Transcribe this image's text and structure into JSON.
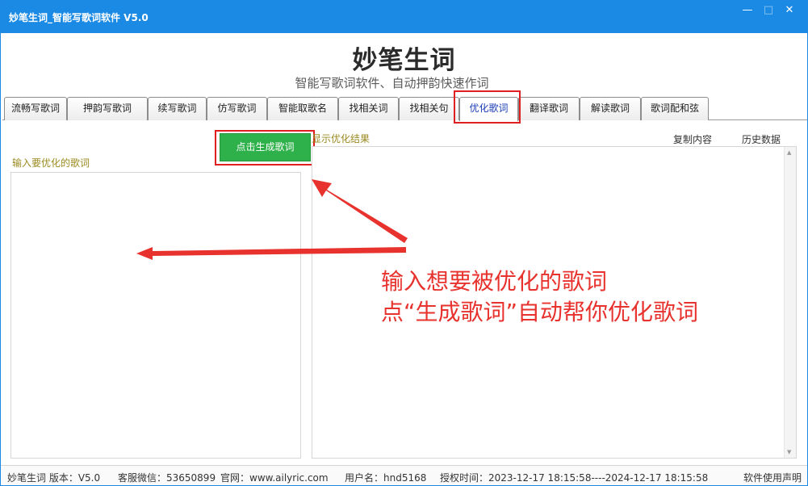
{
  "window": {
    "title": "妙笔生词_智能写歌词软件 V5.0",
    "minimize": "—",
    "maximize": "□",
    "close": "✕"
  },
  "header": {
    "title": "妙笔生词",
    "subtitle": "智能写歌词软件、自动押韵快速作词"
  },
  "tabs": [
    {
      "label": "流畅写歌词"
    },
    {
      "label": "押韵写歌词"
    },
    {
      "label": "续写歌词"
    },
    {
      "label": "仿写歌词"
    },
    {
      "label": "智能取歌名"
    },
    {
      "label": "找相关词"
    },
    {
      "label": "找相关句"
    },
    {
      "label": "优化歌词",
      "active": true
    },
    {
      "label": "翻译歌词"
    },
    {
      "label": "解读歌词"
    },
    {
      "label": "歌词配和弦"
    }
  ],
  "main": {
    "generate_button": "点击生成歌词",
    "input_label": "输入要优化的歌词",
    "input_value": "",
    "result_label": "显示优化结果",
    "copy_link": "复制内容",
    "history_link": "历史数据",
    "result_value": ""
  },
  "annotations": {
    "line1": "输入想要被优化的歌词",
    "line2": "点“生成歌词”自动帮你优化歌词"
  },
  "statusbar": {
    "app_version": "妙笔生词 版本：V5.0",
    "support_wechat": "客服微信：53650899",
    "website": "官网：www.ailyric.com",
    "username": "用户名：hnd5168",
    "license_time": "授权时间：2023-12-17 18:15:58----2024-12-17 18:15:58",
    "disclaimer": "软件使用声明"
  },
  "colors": {
    "titlebar": "#1a8ae5",
    "generate_button": "#2eb14a",
    "annotation_red": "#e8322e",
    "section_label": "#9a8a1e",
    "active_tab_text": "#1a3bb5"
  },
  "icons": {
    "minimize": "minimize-icon",
    "maximize": "maximize-icon",
    "close": "close-icon",
    "arrow": "red-arrow"
  }
}
